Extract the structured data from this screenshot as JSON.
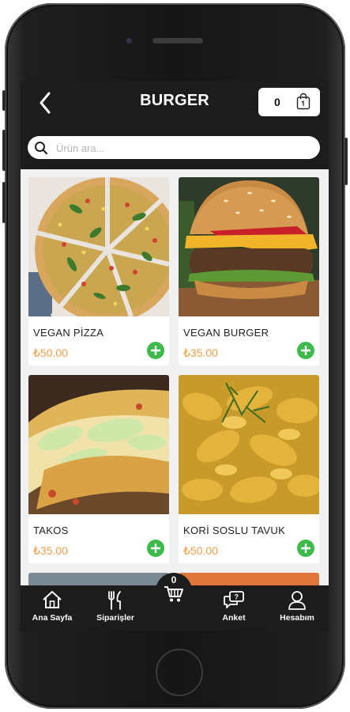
{
  "header": {
    "title": "BURGER",
    "cart_count": "0"
  },
  "search": {
    "placeholder": "Ürün ara..."
  },
  "products": [
    {
      "name": "VEGAN PİZZA",
      "price": "₺50.00"
    },
    {
      "name": "VEGAN BURGER",
      "price": "₺35.00"
    },
    {
      "name": "TAKOS",
      "price": "₺35.00"
    },
    {
      "name": "KORİ SOSLU TAVUK",
      "price": "₺50.00"
    }
  ],
  "bottom_nav": {
    "items": [
      {
        "label": "Ana Sayfa",
        "icon": "home-icon"
      },
      {
        "label": "Siparişler",
        "icon": "fork-knife-icon"
      },
      {
        "label": "Anket",
        "icon": "chat-icon"
      },
      {
        "label": "Hesabım",
        "icon": "user-icon"
      }
    ],
    "cart_count": "0"
  },
  "colors": {
    "topbar": "#1c1c1c",
    "price": "#f19d4a",
    "add_button": "#3dbb4a"
  }
}
